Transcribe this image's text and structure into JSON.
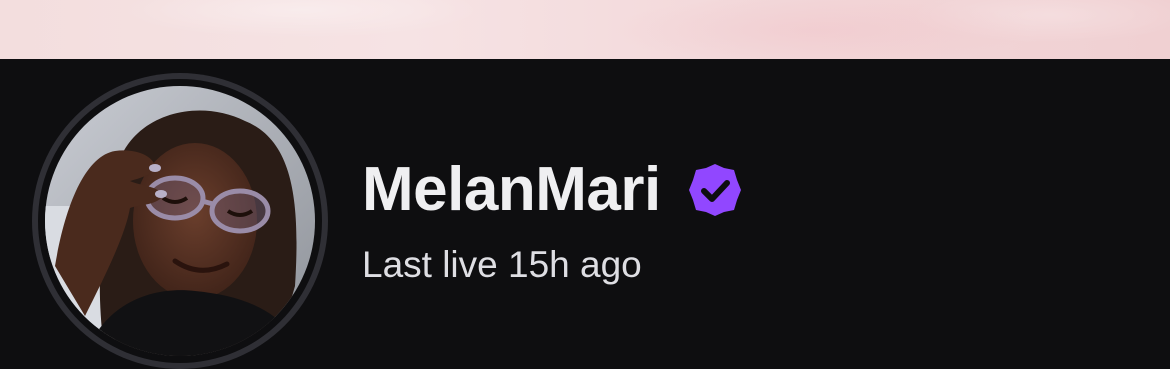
{
  "channel": {
    "name": "MelanMari",
    "verified": true,
    "status_text": "Last live 15h ago"
  },
  "icons": {
    "verified_badge": "verified-check-icon"
  },
  "colors": {
    "background": "#0e0e10",
    "verified_badge": "#9147ff",
    "banner": "#f3dede",
    "avatar_ring": "#2f2f35"
  }
}
